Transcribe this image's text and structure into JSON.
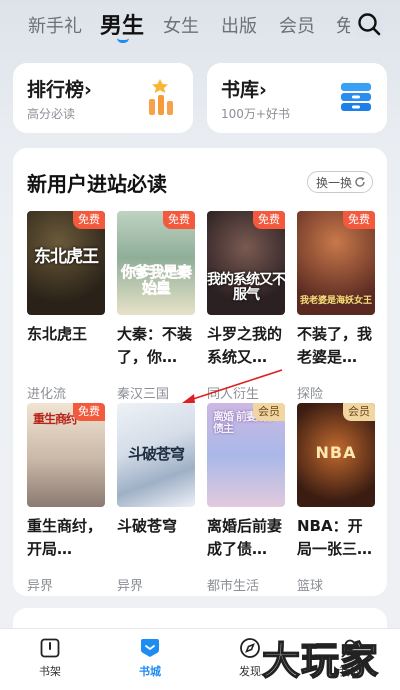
{
  "top_tabs": [
    {
      "label": "新手礼"
    },
    {
      "label": "男生"
    },
    {
      "label": "女生"
    },
    {
      "label": "出版"
    },
    {
      "label": "会员"
    },
    {
      "label": "免"
    }
  ],
  "quick_cards": {
    "ranking": {
      "title": "排行榜›",
      "subtitle": "高分必读"
    },
    "library": {
      "title": "书库›",
      "subtitle": "100万+好书"
    }
  },
  "section": {
    "title": "新用户进站必读",
    "refresh_label": "换一换"
  },
  "books": [
    {
      "name": "东北虎王",
      "category": "进化流",
      "badge": "免费",
      "cover_text": "东北虎王"
    },
    {
      "name": "大秦：不装了，你…",
      "category": "秦汉三国",
      "badge": "免费",
      "cover_text": "你爹我是秦始皇"
    },
    {
      "name": "斗罗之我的系统又…",
      "category": "同人衍生",
      "badge": "免费",
      "cover_text": "我的系统又不服气"
    },
    {
      "name": "不装了，我老婆是…",
      "category": "探险",
      "badge": "免费",
      "cover_text": "我老婆是海妖女王"
    },
    {
      "name": "重生商纣，开局…",
      "category": "异界",
      "badge": "免费",
      "cover_text": "重生商纣"
    },
    {
      "name": "斗破苍穹",
      "category": "异界",
      "badge": "",
      "cover_text": "斗破苍穹"
    },
    {
      "name": "离婚后前妻成了债…",
      "category": "都市生活",
      "badge": "会员",
      "cover_text": "离婚 前妻成了债主"
    },
    {
      "name": "NBA：开局一张三…",
      "category": "篮球",
      "badge": "会员",
      "cover_text": "NBA"
    }
  ],
  "bottom_nav": [
    {
      "label": "书架"
    },
    {
      "label": "书城"
    },
    {
      "label": "发现"
    },
    {
      "label": "我的"
    }
  ],
  "watermark": "大玩家",
  "colors": {
    "accent": "#1e8cf0",
    "free_badge": "#f2593d",
    "vip_badge": "#f1d6a2"
  }
}
